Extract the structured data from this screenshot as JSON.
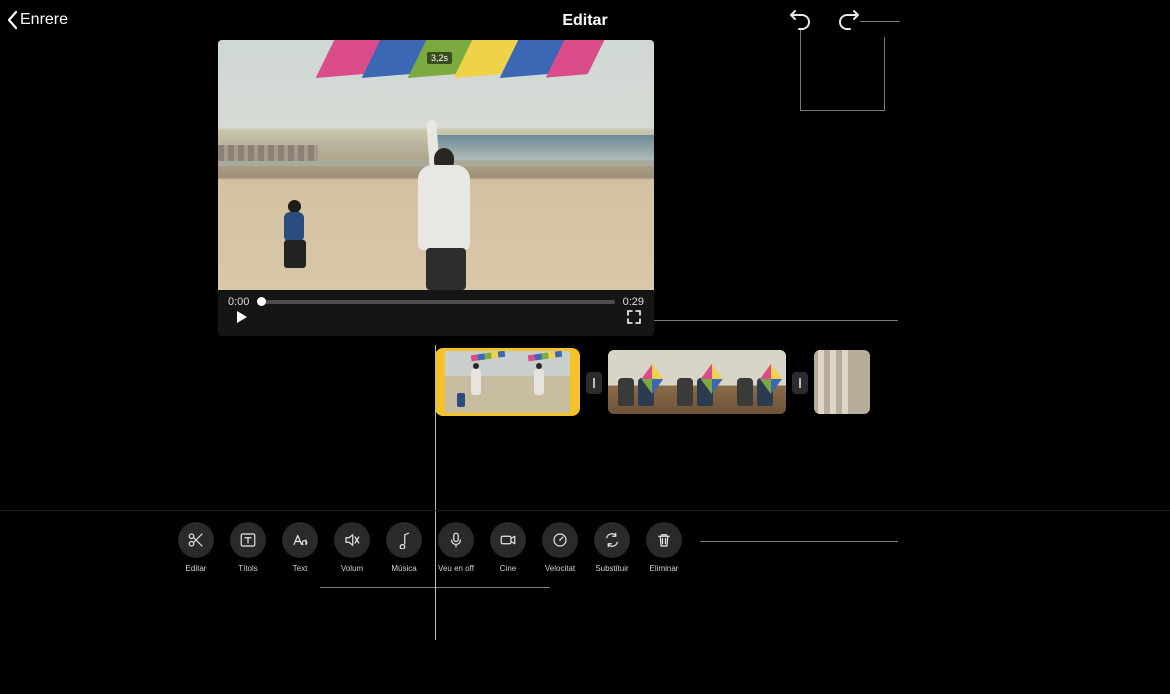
{
  "header": {
    "back_label": "Enrere",
    "title": "Editar"
  },
  "viewer": {
    "clip_duration_badge": "3,2s",
    "current_time": "0:00",
    "total_time": "0:29"
  },
  "toolbar": {
    "edit": "Editar",
    "titles": "Títols",
    "text": "Text",
    "volume": "Volum",
    "music": "Música",
    "voice": "Veu en off",
    "cine": "Cine",
    "speed": "Velocitat",
    "replace": "Substituir",
    "delete": "Eliminar"
  },
  "colors": {
    "selection": "#f6c22b",
    "tool_bg": "#2a2a2c"
  }
}
